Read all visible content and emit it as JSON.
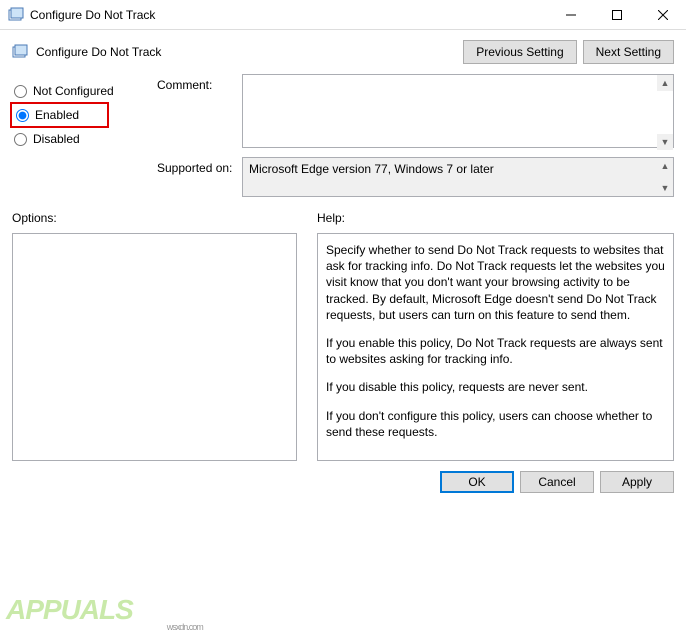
{
  "window": {
    "title": "Configure Do Not Track"
  },
  "header": {
    "title": "Configure Do Not Track",
    "prev_btn": "Previous Setting",
    "next_btn": "Next Setting"
  },
  "radios": {
    "not_configured": "Not Configured",
    "enabled": "Enabled",
    "disabled": "Disabled"
  },
  "fields": {
    "comment_label": "Comment:",
    "comment_value": "",
    "supported_label": "Supported on:",
    "supported_value": "Microsoft Edge version 77, Windows 7 or later"
  },
  "sections": {
    "options_label": "Options:",
    "help_label": "Help:"
  },
  "help": {
    "p1": "Specify whether to send Do Not Track requests to websites that ask for tracking info. Do Not Track requests let the websites you visit know that you don't want your browsing activity to be tracked. By default, Microsoft Edge doesn't send Do Not Track requests, but users can turn on this feature to send them.",
    "p2": "If you enable this policy, Do Not Track requests are always sent to websites asking for tracking info.",
    "p3": "If you disable this policy, requests are never sent.",
    "p4": "If you don't configure this policy, users can choose whether to send these requests."
  },
  "buttons": {
    "ok": "OK",
    "cancel": "Cancel",
    "apply": "Apply"
  },
  "watermark": {
    "text": "APPUALS",
    "url": "wsxdn.com"
  }
}
